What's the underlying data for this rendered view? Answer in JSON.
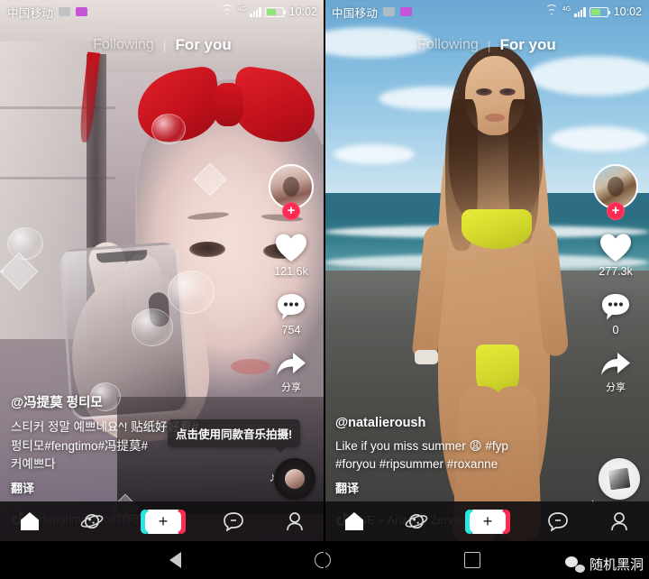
{
  "statusbar": {
    "carrier": "中国移动",
    "time": "10:02",
    "network": "4G",
    "icons": [
      "image-icon",
      "purple-badge-icon",
      "wifi-icon",
      "signal-icon",
      "battery-icon"
    ]
  },
  "tabs": {
    "following": "Following",
    "foryou": "For you",
    "separator": "|",
    "active": "For you"
  },
  "rail": {
    "follow_badge": "+",
    "share_label": "分享"
  },
  "left_post": {
    "handle": "@冯提莫 펑티모",
    "desc_line1": "스티커 정말 예쁘네요^! 贴纸好好看#",
    "desc_line2": "펑티모#fengtimo#冯提莫#",
    "desc_line3": "커예쁘다",
    "translate": "翻译",
    "likes": "121.6k",
    "comments": "754",
    "music": "@fengtimotimo创作的原",
    "tooltip": "点击使用同款音乐拍摄!"
  },
  "right_post": {
    "handle": "@natalieroush",
    "desc_line1": "Like if you miss summer 😩 #fyp",
    "desc_line2": "#foryou #ripsummer #roxanne",
    "translate": "翻译",
    "likes": "277.3k",
    "comments": "0",
    "music": "INE – Arizona Zervas    RC"
  },
  "bottomnav": {
    "items": [
      {
        "name": "home",
        "icon": "home-icon",
        "active": true
      },
      {
        "name": "discover",
        "icon": "planet-icon",
        "active": false
      },
      {
        "name": "create",
        "icon": "plus-icon",
        "label": "+",
        "active": false
      },
      {
        "name": "inbox",
        "icon": "message-icon",
        "active": false
      },
      {
        "name": "profile",
        "icon": "person-icon",
        "active": false
      }
    ]
  },
  "androidnav": {
    "back": "back-icon",
    "home": "home-circle-icon",
    "recents": "square-icon"
  },
  "watermark": {
    "text": "随机黑洞",
    "icon": "wechat-icon"
  },
  "colors": {
    "accent_red": "#fe2c55",
    "accent_cyan": "#29e7e0",
    "battery_green": "#8fe37a"
  }
}
